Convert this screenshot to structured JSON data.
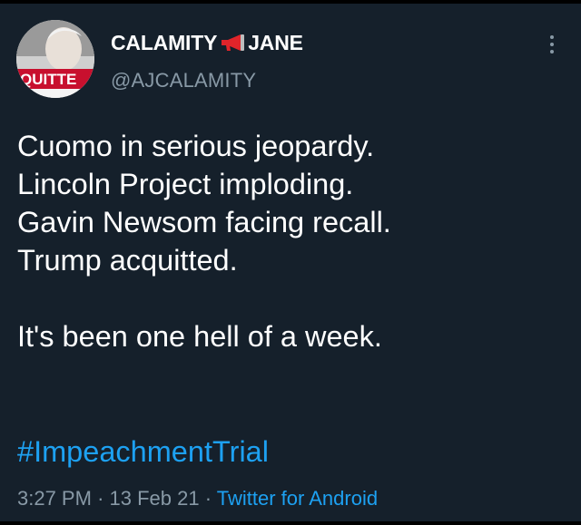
{
  "tweet": {
    "display_name_part1": "CALAMITY",
    "display_name_part2": "JANE",
    "handle": "@AJCALAMITY",
    "avatar_label": "QUITTE",
    "lines": [
      "Cuomo in serious jeopardy.",
      "Lincoln Project imploding.",
      "Gavin Newsom facing recall.",
      "Trump acquitted."
    ],
    "closing_line": "It's been one hell of a week.",
    "hashtag": "#ImpeachmentTrial",
    "time": "3:27 PM",
    "separator": "·",
    "date": "13 Feb 21",
    "source": "Twitter for Android"
  },
  "icons": {
    "name_emoji": "megaphone-icon",
    "menu": "more-options-icon"
  },
  "colors": {
    "background": "#15202b",
    "text": "#ffffff",
    "secondary": "#8899a6",
    "link": "#1da1f2",
    "megaphone": "#e0242a"
  }
}
